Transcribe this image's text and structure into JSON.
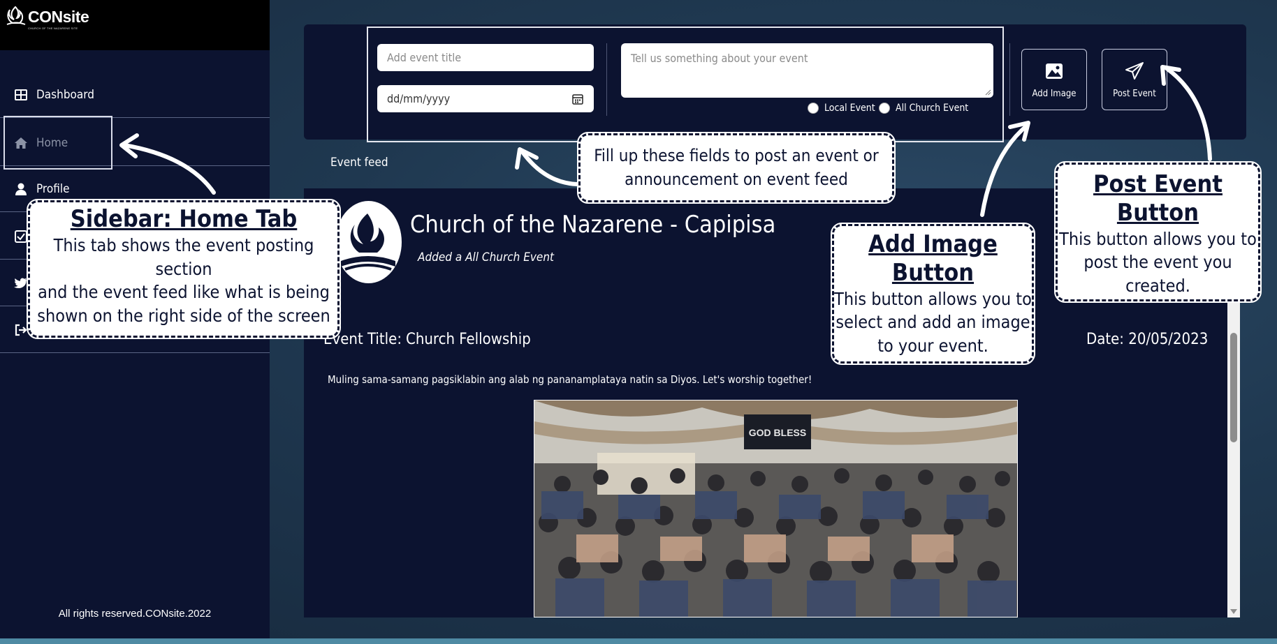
{
  "brand": {
    "logo_text": "CONsite",
    "logo_subtitle": "CHURCH OF THE NAZARENE SITE"
  },
  "sidebar": {
    "items": [
      {
        "label": "Dashboard",
        "icon": "dashboard-icon"
      },
      {
        "label": "Home",
        "icon": "home-icon"
      },
      {
        "label": "Profile",
        "icon": "user-icon"
      },
      {
        "label": "",
        "icon": "checkbox-icon"
      },
      {
        "label": "",
        "icon": "twitter-icon"
      },
      {
        "label": "",
        "icon": "logout-icon"
      }
    ],
    "footer": "All rights reserved.CONsite.2022"
  },
  "event_form": {
    "title_placeholder": "Add event title",
    "date_placeholder": "dd/mm/yyyy",
    "description_placeholder": "Tell us something about your event",
    "radio_local": "Local Event",
    "radio_all": "All Church Event",
    "add_image_label": "Add Image",
    "post_event_label": "Post Event"
  },
  "feed": {
    "label": "Event feed",
    "post": {
      "org_name": "Church of the Nazarene - Capipisa",
      "subtitle": "Added a All Church Event",
      "title_label": "Event Title:",
      "title": "Church Fellowship",
      "date": "Date: 20/05/2023",
      "body": "Muling sama-samang pagsiklabin ang alab ng pananamplataya natin sa Diyos. Let's worship together!",
      "photo_banner": "GOD BLESS"
    }
  },
  "callouts": {
    "home": {
      "title": "Sidebar: Home Tab",
      "body_lines": [
        "This tab shows the event posting section",
        "and the event feed like what is being",
        "shown on the right side of the screen"
      ]
    },
    "fields": {
      "body_lines": [
        "Fill up these fields to post an event or",
        "announcement on event feed"
      ]
    },
    "add_image": {
      "title": "Add Image Button",
      "body_lines": [
        "This button allows you to",
        "select and add an image",
        "to your event."
      ]
    },
    "post_event": {
      "title": "Post Event Button",
      "body_lines": [
        "This button allows you to",
        "post the event you",
        "created."
      ]
    }
  },
  "colors": {
    "panel": "#0c1330",
    "background": "#1f3850",
    "accent_band": "#4f8aa3"
  }
}
